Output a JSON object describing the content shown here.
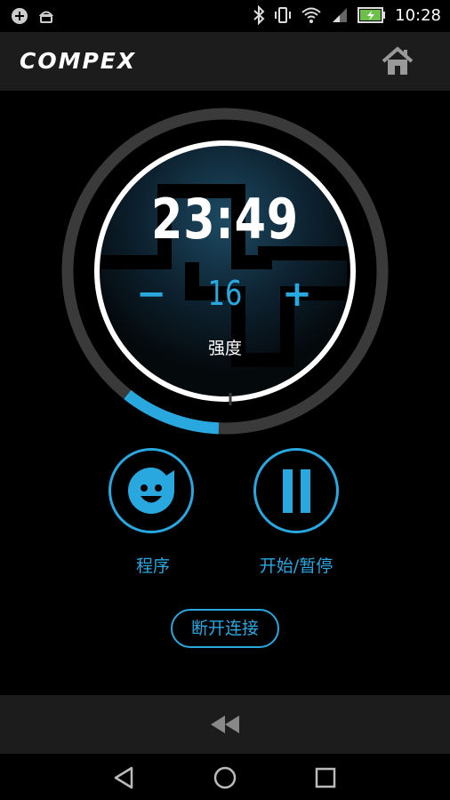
{
  "status_bar": {
    "time": "10:28",
    "icons": [
      "notification-icon",
      "android-icon",
      "bluetooth-icon",
      "vibrate-icon",
      "wifi-icon",
      "signal-icon",
      "battery-charging-icon"
    ]
  },
  "app_bar": {
    "logo": "COMPEX",
    "home_icon": "home-icon"
  },
  "session": {
    "timer": "23:49",
    "intensity_value": "16",
    "intensity_label": "强度",
    "decrease_label": "−",
    "increase_label": "+",
    "progress_fraction": 0.1
  },
  "actions": {
    "program_label": "程序",
    "program_icon": "smiley-face-icon",
    "play_pause_label": "开始/暂停",
    "play_pause_icon": "pause-icon",
    "disconnect_label": "断开连接"
  },
  "bottom_bar": {
    "rewind_icon": "rewind-icon"
  },
  "nav_bar": {
    "icons": [
      "back-icon",
      "home-circle-icon",
      "recents-icon"
    ]
  },
  "colors": {
    "accent": "#29a8e0",
    "ring_track": "#3a3a3a",
    "bar_background": "#1c1c1c"
  }
}
